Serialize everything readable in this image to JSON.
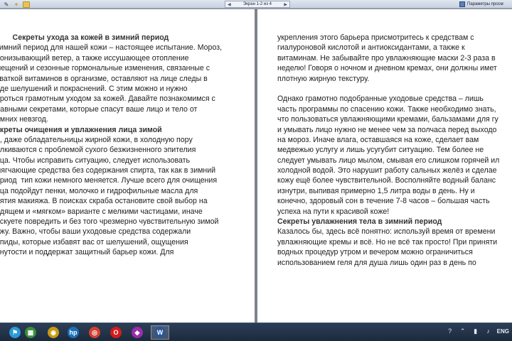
{
  "toolbar": {
    "pager_label": "Экран 1-2 из 4",
    "params_label": "Параметры просм"
  },
  "left_page": {
    "lines": [
      {
        "text": "        Секреты ухода за кожей в зимний период",
        "style": "h"
      },
      {
        "text": "зимний период для нашей кожи – настоящее испытание. Мороз,",
        "style": ""
      },
      {
        "text": "ронизывающий ветер, а также иссушающее отопление",
        "style": ""
      },
      {
        "text": "мещений и сезонные гормональные изменения, связанные с",
        "style": ""
      },
      {
        "text": "хваткой витаминов в организме, оставляют на лице следы в",
        "style": ""
      },
      {
        "text": "иде шелушений и покраснений. С этим можно и нужно",
        "style": ""
      },
      {
        "text": "ороться грамотным уходом за кожей. Давайте познакомимся с",
        "style": ""
      },
      {
        "text": "лавными секретами, которые спасут ваше лицо и тело от",
        "style": ""
      },
      {
        "text": "имних невзгод.",
        "style": ""
      },
      {
        "text": "екреты очищения и увлажнения лица зимой",
        "style": "h"
      },
      {
        "text": "е, даже обладательницы жирной кожи, в холодную пору",
        "style": ""
      },
      {
        "text": "алкиваются с проблемой сухого безжизненного эпителия",
        "style": ""
      },
      {
        "text": "ица. Чтобы исправить ситуацию, следует использовать",
        "style": ""
      },
      {
        "text": "мягчающие средства без содержания спирта, так как в зимний",
        "style": ""
      },
      {
        "text": "ериод  тип кожи немного меняется. Лучше всего для очищения",
        "style": ""
      },
      {
        "text": "ица подойдут пенки, молочко и гидрофильные масла для",
        "style": ""
      },
      {
        "text": "нятия макияжа. В поисках скраба остановите свой выбор на",
        "style": ""
      },
      {
        "text": "адящем и «мягком» варианте с мелкими частицами, иначе",
        "style": ""
      },
      {
        "text": "искуете повредить и без того чрезмерно чувствительную зимой",
        "style": ""
      },
      {
        "text": "ожу. Важно, чтобы ваши уходовые средства содержали",
        "style": ""
      },
      {
        "text": "ипиды, которые избавят вас от шелушений, ощущения",
        "style": ""
      },
      {
        "text": "янутости и поддержат защитный барьер кожи. Для",
        "style": ""
      }
    ]
  },
  "right_page": {
    "lines": [
      {
        "text": "укрепления этого барьера присмотритесь к средствам с",
        "style": ""
      },
      {
        "text": "гиалуроновой кислотой и антиоксидантами, а также к",
        "style": ""
      },
      {
        "text": "витаминам. Не забывайте про увлажняющие маски 2-3 раза в",
        "style": ""
      },
      {
        "text": "неделю! Говоря о ночном и дневном кремах, они должны имет",
        "style": ""
      },
      {
        "text": "плотную жирную текстуру.",
        "style": ""
      },
      {
        "text": "",
        "style": "gap"
      },
      {
        "text": "Однако грамотно подобранные уходовые средства – лишь",
        "style": ""
      },
      {
        "text": "часть программы по спасению кожи. Также необходимо знать,",
        "style": ""
      },
      {
        "text": "что пользоваться увлажняющими кремами, бальзамами для гу",
        "style": ""
      },
      {
        "text": "и умывать лицо нужно не менее чем за полчаса перед выходо",
        "style": ""
      },
      {
        "text": "на мороз. Иначе влага, оставшаяся на коже, сделает вам",
        "style": ""
      },
      {
        "text": "медвежью услугу и лишь усугубит ситуацию. Тем более не",
        "style": ""
      },
      {
        "text": "следует умывать лицо мылом, смывая его слишком горячей ил",
        "style": ""
      },
      {
        "text": "холодной водой. Это нарушит работу сальных желёз и сделае",
        "style": ""
      },
      {
        "text": "кожу ещё более чувствительной. Восполняйте водный баланс",
        "style": ""
      },
      {
        "text": "изнутри, выпивая примерно 1,5 литра воды в день. Ну и",
        "style": ""
      },
      {
        "text": "конечно, здоровый сон в течение 7-8 часов – большая часть",
        "style": ""
      },
      {
        "text": "успеха на пути к красивой коже!",
        "style": ""
      },
      {
        "text": "Секреты увлажнения тела в зимний период",
        "style": "h"
      },
      {
        "text": "Казалось бы, здесь всё понятно: используй время от времени",
        "style": ""
      },
      {
        "text": "увлажняющие кремы и всё. Но не всё так просто! При приняти",
        "style": ""
      },
      {
        "text": "водных процедур утром и вечером можно ограничиться",
        "style": ""
      },
      {
        "text": "использованием геля для душа лишь один раз в день по",
        "style": ""
      }
    ]
  },
  "taskbar": {
    "apps": [
      {
        "name": "flag",
        "glyph": "⚑",
        "color": "#2a9ad6"
      },
      {
        "name": "store",
        "glyph": "▦",
        "color": "#3a8f3a"
      },
      {
        "name": "game",
        "glyph": "◉",
        "color": "#c89a10"
      },
      {
        "name": "hp",
        "glyph": "hp",
        "color": "#1b6fb8"
      },
      {
        "name": "chrome",
        "glyph": "◎",
        "color": "#d2402f"
      },
      {
        "name": "opera",
        "glyph": "O",
        "color": "#d31b1b"
      },
      {
        "name": "shield",
        "glyph": "◆",
        "color": "#9a2ea8"
      },
      {
        "name": "word",
        "glyph": "W",
        "color": "#2b5797"
      }
    ],
    "lang": "ENG"
  }
}
